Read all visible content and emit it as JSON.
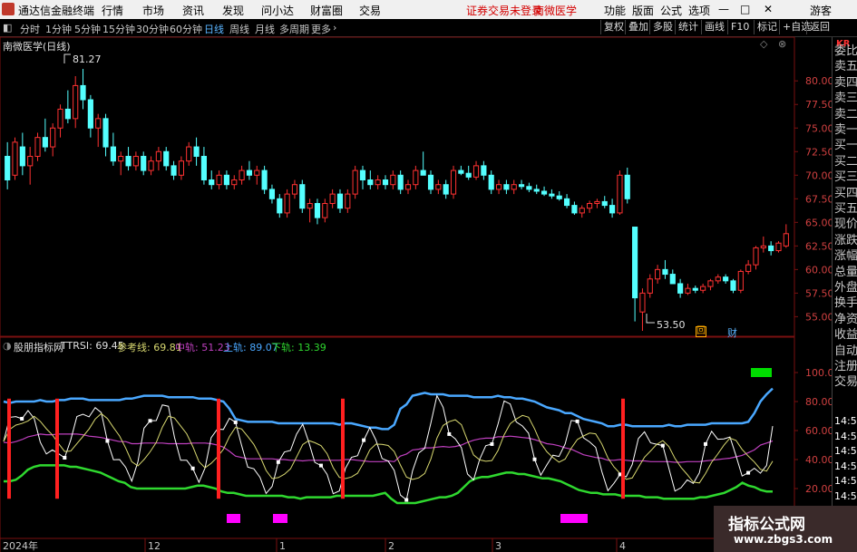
{
  "menubar": {
    "app_title": "通达信金融终端",
    "menus": [
      "行情",
      "市场",
      "资讯",
      "发现",
      "问小达",
      "财富圈",
      "交易"
    ],
    "notice": "证券交易未登录",
    "stock": "南微医学",
    "right_menus": [
      "功能",
      "版面",
      "公式",
      "选项"
    ],
    "guest": "游客"
  },
  "toolbar": {
    "periods": [
      "分时",
      "1分钟",
      "5分钟",
      "15分钟",
      "30分钟",
      "60分钟",
      "日线",
      "周线",
      "月线",
      "多周期",
      "更多"
    ],
    "active_period": "日线",
    "buttons": [
      "复权",
      "叠加",
      "多股",
      "统计",
      "画线",
      "F10",
      "标记",
      "+自选",
      "返回"
    ]
  },
  "main_chart": {
    "title": "南微医学(日线)",
    "high_label": "81.27",
    "low_label": "53.50",
    "price_ticks": [
      "80.00",
      "77.50",
      "75.00",
      "72.50",
      "70.00",
      "67.50",
      "65.00",
      "62.50",
      "60.00",
      "57.50",
      "55.00"
    ],
    "markers": [
      "回",
      "财"
    ]
  },
  "indicator": {
    "name": "股朋指标网",
    "ttrsi_label": "TTRSI: 69.45",
    "ref_label": "参考线: 69.81",
    "mid_label": "中轨: 51.23",
    "upper_label": "上轨: 89.07",
    "lower_label": "下轨: 13.39",
    "ticks": [
      "100.0",
      "80.00",
      "60.00",
      "40.00",
      "20.00"
    ]
  },
  "date_axis": [
    "2024年",
    "12",
    "1",
    "2",
    "3",
    "4"
  ],
  "right_panel": {
    "tag": "KR",
    "items": [
      "委比",
      "卖五",
      "卖四",
      "卖三",
      "卖二",
      "卖一",
      "买一",
      "买二",
      "买三",
      "买四",
      "买五",
      "现价",
      "涨跌",
      "涨幅",
      "总量",
      "外盘",
      "换手",
      "净资",
      "收益",
      "自动",
      "注册",
      "交易"
    ]
  },
  "time_panel": [
    "14:55",
    "14:55",
    "14:55",
    "14:56",
    "14:56",
    "14:56",
    "14:56",
    "14:56"
  ],
  "watermark": {
    "line1": "指标公式网",
    "line2": "www.zbgs3.com"
  },
  "colors": {
    "up": "#ff3232",
    "down": "#54ffff",
    "upper_band": "#4aa8ff",
    "lower_band": "#2fd82f",
    "mid_band": "#c040c0",
    "ttrsi": "#ffffff",
    "ref": "#d8d870",
    "signal_bar": "#ff2020",
    "magenta_block": "#ff00ff",
    "green_block": "#00dd00"
  },
  "chart_data": {
    "type": "candlestick",
    "price_ylim": [
      53.5,
      83
    ],
    "candles": [
      [
        72,
        73.5,
        68.5,
        69.5
      ],
      [
        70,
        74,
        69.5,
        73.5
      ],
      [
        73,
        74.5,
        70,
        71
      ],
      [
        71,
        73,
        69,
        72
      ],
      [
        72,
        74.5,
        71.5,
        74
      ],
      [
        74,
        76,
        72.5,
        73
      ],
      [
        73,
        75.5,
        72,
        75
      ],
      [
        75,
        77.5,
        74,
        77
      ],
      [
        77,
        79,
        75.5,
        76
      ],
      [
        76,
        80.5,
        75,
        79.5
      ],
      [
        79.5,
        81.27,
        77,
        78
      ],
      [
        78,
        78.5,
        74,
        75
      ],
      [
        75,
        76.5,
        73,
        76
      ],
      [
        76,
        76.5,
        72,
        73
      ],
      [
        73,
        74.5,
        71,
        71.5
      ],
      [
        71.5,
        72.5,
        70,
        72
      ],
      [
        72,
        73,
        70.5,
        71
      ],
      [
        71,
        72.5,
        70.5,
        72
      ],
      [
        72,
        72.5,
        70,
        70.5
      ],
      [
        70.5,
        72,
        70,
        71.5
      ],
      [
        71.5,
        73,
        70.5,
        72.5
      ],
      [
        72.5,
        73,
        70.5,
        71
      ],
      [
        71,
        71.5,
        69.5,
        70
      ],
      [
        70,
        72,
        69.5,
        71.5
      ],
      [
        71.5,
        73.5,
        71,
        73
      ],
      [
        73,
        74,
        71,
        72
      ],
      [
        72,
        73,
        69,
        69.5
      ],
      [
        69.5,
        70.5,
        68.5,
        69
      ],
      [
        69,
        70.5,
        68.5,
        70
      ],
      [
        70,
        70.5,
        68.5,
        69
      ],
      [
        69,
        70,
        68.5,
        69.5
      ],
      [
        69.5,
        71,
        69,
        70.5
      ],
      [
        70.5,
        71.5,
        69.5,
        70
      ],
      [
        70,
        71,
        69,
        70.5
      ],
      [
        70.5,
        71,
        68,
        68.5
      ],
      [
        68.5,
        69,
        67,
        67.5
      ],
      [
        67.5,
        68,
        65.5,
        66
      ],
      [
        66,
        68.5,
        65.5,
        68
      ],
      [
        68,
        69.5,
        67.5,
        69
      ],
      [
        69,
        69.5,
        66,
        66.5
      ],
      [
        66.5,
        67.5,
        65,
        67
      ],
      [
        67,
        67.5,
        64.8,
        65.5
      ],
      [
        65.5,
        67.5,
        65,
        67
      ],
      [
        67,
        68.5,
        66.5,
        68
      ],
      [
        68,
        68.5,
        66,
        66.5
      ],
      [
        66.5,
        68.5,
        66,
        68
      ],
      [
        68,
        71,
        67.5,
        70.5
      ],
      [
        70.5,
        71,
        68.5,
        69.5
      ],
      [
        69.5,
        70.5,
        68.5,
        69
      ],
      [
        69,
        70,
        68.5,
        69.5
      ],
      [
        69.5,
        70,
        68.5,
        69
      ],
      [
        69,
        70.5,
        68.5,
        70
      ],
      [
        70,
        70.5,
        68,
        68.5
      ],
      [
        68.5,
        69.5,
        68,
        69
      ],
      [
        69,
        71,
        68.5,
        70.5
      ],
      [
        70.5,
        72.5,
        70,
        70
      ],
      [
        70,
        70.5,
        68,
        68.5
      ],
      [
        68.5,
        69.5,
        68,
        69
      ],
      [
        69,
        69.5,
        67.5,
        68
      ],
      [
        68,
        71,
        67.5,
        70.5
      ],
      [
        70.5,
        71,
        70,
        70.2
      ],
      [
        70.2,
        71,
        69.5,
        69.8
      ],
      [
        69.8,
        71.5,
        69.5,
        71
      ],
      [
        71,
        71.5,
        69.5,
        70
      ],
      [
        70,
        70.5,
        68,
        68.5
      ],
      [
        68.5,
        69.5,
        68,
        69
      ],
      [
        69,
        69.5,
        68,
        68.5
      ],
      [
        68.5,
        69.5,
        68,
        69
      ],
      [
        69,
        69.5,
        68.5,
        68.8
      ],
      [
        68.8,
        69.2,
        68.2,
        68.5
      ],
      [
        68.5,
        69,
        68,
        68.3
      ],
      [
        68.3,
        68.8,
        67.8,
        68
      ],
      [
        68,
        68.5,
        67.5,
        67.8
      ],
      [
        67.8,
        68.3,
        67.3,
        67.5
      ],
      [
        67.5,
        68,
        66.5,
        66.8
      ],
      [
        66.8,
        67.2,
        65.8,
        66
      ],
      [
        66,
        66.8,
        65.5,
        66.5
      ],
      [
        66.5,
        67.3,
        66,
        67
      ],
      [
        67,
        67.5,
        66.5,
        67.2
      ],
      [
        67.2,
        67.8,
        66.5,
        66.8
      ],
      [
        66.8,
        67.5,
        65.5,
        66
      ],
      [
        66,
        70.5,
        65.8,
        70
      ],
      [
        70,
        70.8,
        67,
        67.5
      ],
      [
        64.5,
        64.5,
        54.5,
        57
      ],
      [
        55.5,
        58,
        53.5,
        57.5
      ],
      [
        57.5,
        59.5,
        57,
        59
      ],
      [
        59,
        60.5,
        58.5,
        60
      ],
      [
        60,
        61,
        59,
        59.5
      ],
      [
        59.5,
        60,
        58.5,
        58.5
      ],
      [
        58.5,
        59,
        57,
        57.5
      ],
      [
        57.5,
        58.5,
        57.3,
        58
      ],
      [
        58,
        58.3,
        57.5,
        57.8
      ],
      [
        57.8,
        58.5,
        57.5,
        58.2
      ],
      [
        58.2,
        59,
        57.8,
        58.8
      ],
      [
        58.8,
        59.5,
        58.5,
        59.2
      ],
      [
        59.2,
        59.5,
        58.5,
        58.8
      ],
      [
        58.8,
        59,
        57.5,
        57.8
      ],
      [
        57.8,
        60,
        57.5,
        59.8
      ],
      [
        59.8,
        61,
        59.5,
        60.5
      ],
      [
        60.5,
        62.5,
        60,
        62.3
      ],
      [
        62.3,
        63.5,
        61.8,
        62.5
      ],
      [
        62.5,
        63,
        61.5,
        62
      ],
      [
        62,
        63,
        61.8,
        62.8
      ],
      [
        62.5,
        64.8,
        62.3,
        63.8
      ]
    ],
    "indicator_ylim": [
      10,
      110
    ],
    "upper": [
      80,
      79,
      80,
      80,
      80,
      80,
      81,
      80,
      80,
      81,
      81,
      82,
      82,
      82,
      81,
      81,
      81,
      81,
      81,
      81,
      82,
      82,
      83,
      84,
      84,
      84,
      84,
      83,
      83,
      83,
      83,
      83,
      82,
      82,
      82,
      81,
      80,
      75,
      68,
      67,
      66,
      66,
      66,
      66,
      66,
      65,
      65,
      65,
      65,
      65,
      65,
      65,
      65,
      65,
      65,
      64,
      65,
      65,
      64,
      63,
      62,
      62,
      61,
      61,
      64,
      75,
      78,
      84,
      85,
      86,
      85,
      85,
      85,
      84,
      84,
      84,
      84,
      83,
      83,
      83,
      83,
      84,
      83,
      83,
      82,
      82,
      81,
      80,
      78,
      76,
      75,
      74,
      72,
      72,
      70,
      68,
      67,
      66,
      65,
      63,
      63,
      64,
      64,
      63,
      63,
      63,
      63,
      63,
      63,
      64,
      63,
      63,
      64,
      64,
      64,
      64,
      65,
      65,
      65,
      65,
      65,
      65,
      66,
      72,
      80,
      85,
      89
    ],
    "lower": [
      25,
      25,
      26,
      29,
      33,
      35,
      36,
      36,
      36,
      36,
      36,
      35,
      35,
      34,
      33,
      32,
      31,
      29,
      27,
      25,
      24,
      21,
      20,
      20,
      20,
      20,
      20,
      20,
      20,
      20,
      20,
      21,
      22,
      22,
      21,
      20,
      18,
      17,
      17,
      16,
      15,
      15,
      15,
      15,
      15,
      15,
      15,
      14,
      14,
      13,
      14,
      14,
      14,
      14,
      14,
      15,
      15,
      15,
      15,
      15,
      15,
      15,
      16,
      17,
      13,
      10,
      10,
      10,
      10,
      11,
      12,
      13,
      14,
      14,
      15,
      17,
      21,
      25,
      27,
      28,
      28,
      29,
      30,
      31,
      31,
      30,
      30,
      29,
      28,
      27,
      27,
      26,
      25,
      23,
      21,
      19,
      18,
      17,
      17,
      16,
      16,
      16,
      15,
      15,
      15,
      15,
      14,
      14,
      14,
      13,
      13,
      13,
      13,
      13,
      13,
      14,
      14,
      15,
      16,
      17,
      19,
      21,
      24,
      22,
      21,
      19,
      18,
      18
    ]
  }
}
